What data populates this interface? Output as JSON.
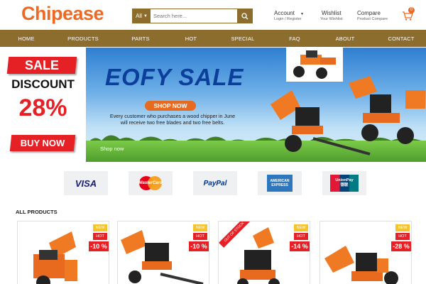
{
  "header": {
    "logo": "Chipease",
    "search": {
      "category": "All",
      "placeholder": "Search here..."
    },
    "account": {
      "title": "Account",
      "subtitle": "Login / Register"
    },
    "wishlist": {
      "title": "Wishlist",
      "subtitle": "Your Wishlist"
    },
    "compare": {
      "title": "Compare",
      "subtitle": "Product Compare"
    },
    "cart_count": "0"
  },
  "nav": [
    "HOME",
    "PRODUCTS",
    "PARTS",
    "HOT",
    "SPECIAL",
    "FAQ",
    "ABOUT",
    "CONTACT"
  ],
  "promo": {
    "sale": "SALE",
    "discount": "DISCOUNT",
    "percent": "28%",
    "button": "BUY NOW"
  },
  "banner": {
    "title": "EOFY SALE",
    "button": "SHOP NOW",
    "text": "Every customer who purchases a wood chipper in June will receive two free blades and two free belts.",
    "link": "Shop now"
  },
  "payments": [
    "VISA",
    "MasterCard",
    "PayPal",
    "AMERICAN EXPRESS",
    "UnionPay 银联"
  ],
  "section_title": "ALL PRODUCTS",
  "products": [
    {
      "new": "NEW",
      "hot": "HOT",
      "discount": "-10 %"
    },
    {
      "new": "NEW",
      "hot": "HOT",
      "discount": "-10 %"
    },
    {
      "new": "NEW",
      "hot": "HOT",
      "discount": "-14 %",
      "ribbon": "OUT OF STOCK"
    },
    {
      "new": "NEW",
      "hot": "HOT",
      "discount": "-28 %"
    }
  ],
  "colors": {
    "brand": "#ec6a24",
    "nav": "#8c6d2e",
    "sale_red": "#e52125",
    "badge_new": "#f5c32a"
  }
}
